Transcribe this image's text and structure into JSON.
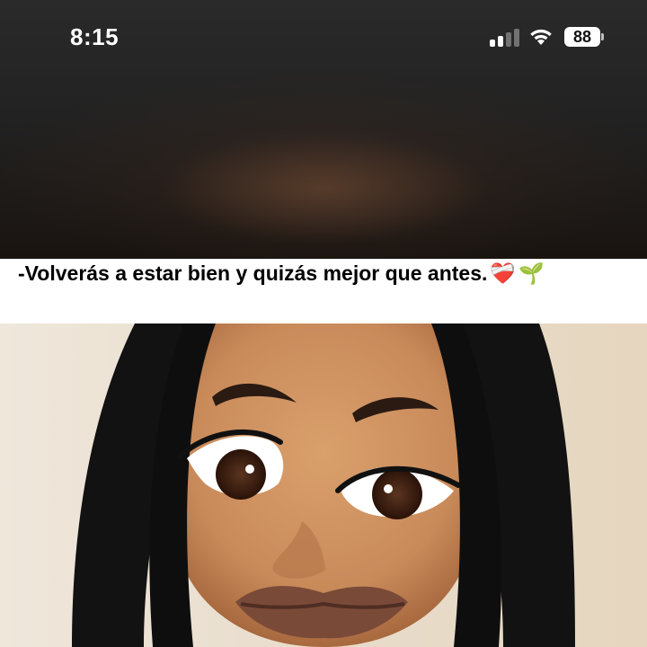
{
  "status_bar": {
    "time": "8:15",
    "battery": "88",
    "signal_bars_active": 2,
    "signal_bars_total": 4
  },
  "post": {
    "caption": "-Volverás a estar bien y quizás mejor que antes.",
    "emojis": [
      {
        "name": "mending-heart-emoji",
        "glyph": "❤️‍🩹"
      },
      {
        "name": "seedling-emoji",
        "glyph": "🌱"
      }
    ]
  },
  "colors": {
    "caption_bg": "#ffffff",
    "skin": "#c98a5a",
    "hair": "#121212",
    "wall": "#eadfcf",
    "lips": "#7a4a38"
  }
}
